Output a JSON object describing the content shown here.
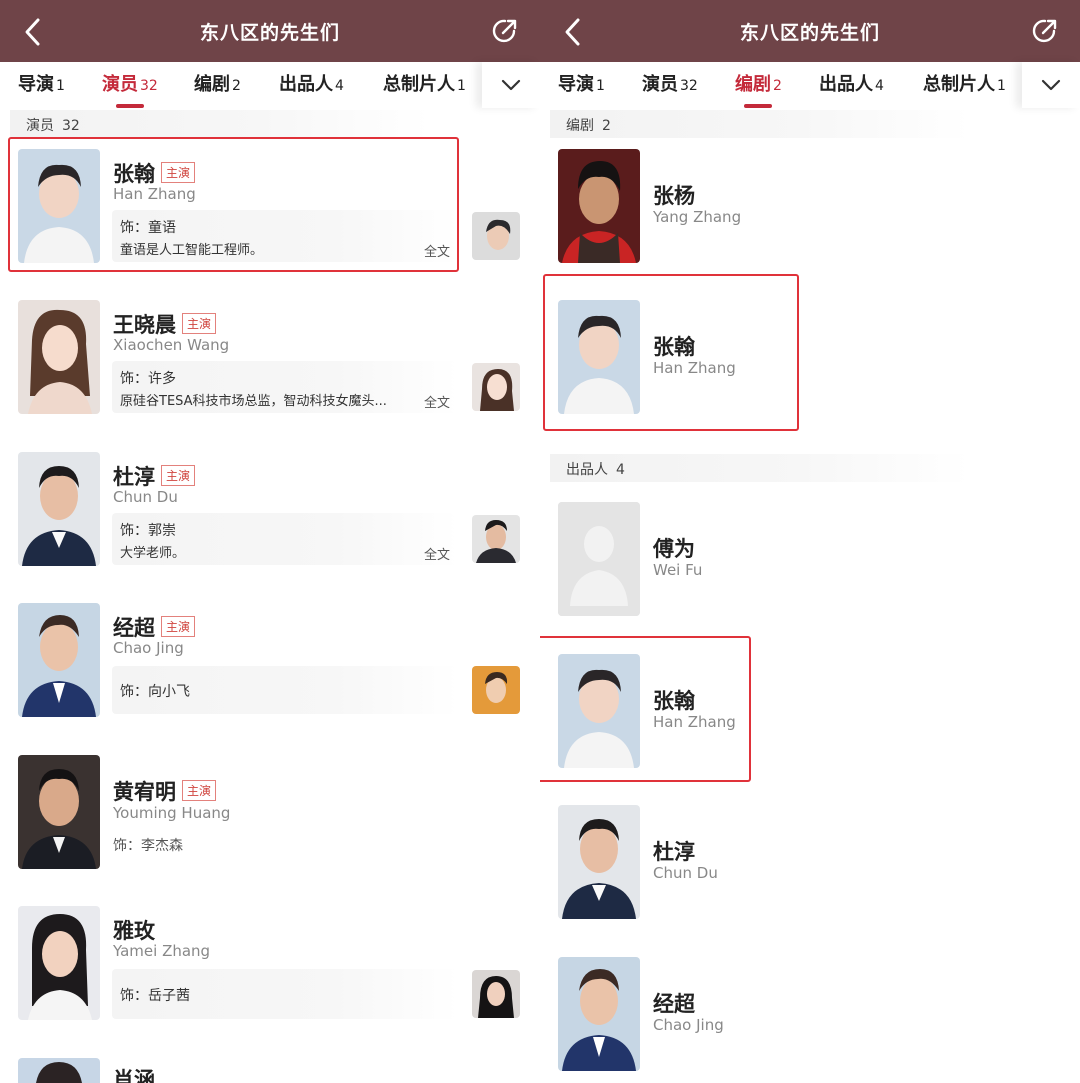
{
  "left": {
    "title": "东八区的先生们",
    "tabs": [
      {
        "label": "导演",
        "count": "1"
      },
      {
        "label": "演员",
        "count": "32"
      },
      {
        "label": "编剧",
        "count": "2"
      },
      {
        "label": "出品人",
        "count": "4"
      },
      {
        "label": "总制片人",
        "count": "1"
      }
    ],
    "active_tab": "演员",
    "section": {
      "label": "演员",
      "count": "32"
    },
    "people": [
      {
        "name": "张翰",
        "badge": "主演",
        "ename": "Han Zhang",
        "role": "饰：童语",
        "desc": "童语是人工智能工程师。",
        "full": "全文"
      },
      {
        "name": "王晓晨",
        "badge": "主演",
        "ename": "Xiaochen Wang",
        "role": "饰：许多",
        "desc": "原硅谷TESA科技市场总监，智动科技女魔头...",
        "full": "全文"
      },
      {
        "name": "杜淳",
        "badge": "主演",
        "ename": "Chun Du",
        "role": "饰：郭崇",
        "desc": "大学老师。",
        "full": "全文"
      },
      {
        "name": "经超",
        "badge": "主演",
        "ename": "Chao Jing",
        "role": "饰：向小飞"
      },
      {
        "name": "黄宥明",
        "badge": "主演",
        "ename": "Youming Huang",
        "role": "饰：李杰森"
      },
      {
        "name": "雅玫",
        "ename": "Yamei Zhang",
        "role": "饰：岳子茜"
      },
      {
        "name": "肖涵"
      }
    ]
  },
  "right": {
    "title": "东八区的先生们",
    "tabs": [
      {
        "label": "导演",
        "count": "1"
      },
      {
        "label": "演员",
        "count": "32"
      },
      {
        "label": "编剧",
        "count": "2"
      },
      {
        "label": "出品人",
        "count": "4"
      },
      {
        "label": "总制片人",
        "count": "1"
      }
    ],
    "active_tab": "编剧",
    "writers_section": {
      "label": "编剧",
      "count": "2"
    },
    "writers": [
      {
        "name": "张杨",
        "ename": "Yang Zhang"
      },
      {
        "name": "张翰",
        "ename": "Han Zhang"
      }
    ],
    "producers_section": {
      "label": "出品人",
      "count": "4"
    },
    "producers": [
      {
        "name": "傅为",
        "ename": "Wei Fu"
      },
      {
        "name": "张翰",
        "ename": "Han Zhang"
      },
      {
        "name": "杜淳",
        "ename": "Chun Du"
      },
      {
        "name": "经超",
        "ename": "Chao Jing"
      }
    ]
  },
  "colors": {
    "topbar": "#6f4448",
    "accent": "#c42a3a",
    "highlight": "#e0323a"
  },
  "icons": [
    "back-arrow-icon",
    "share-icon",
    "chevron-down-icon",
    "placeholder-avatar-icon"
  ]
}
